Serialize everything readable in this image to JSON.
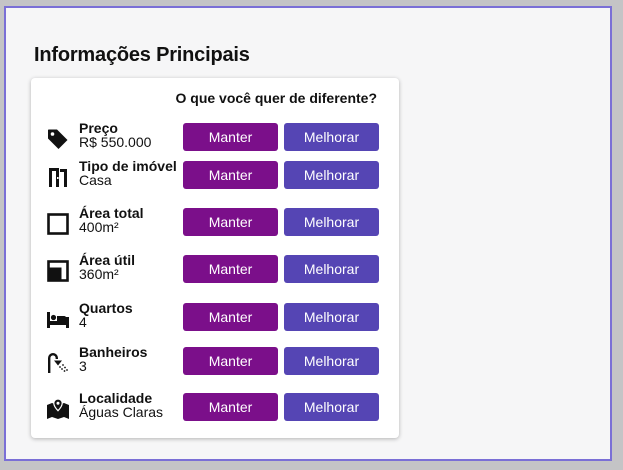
{
  "page": {
    "title": "Informações Principais"
  },
  "card": {
    "question": "O que você quer de diferente?",
    "keep_label": "Manter",
    "improve_label": "Melhorar",
    "rows": [
      {
        "label": "Preço",
        "value": "R$ 550.000",
        "icon": "price-tag-icon"
      },
      {
        "label": "Tipo de imóvel",
        "value": "Casa",
        "icon": "door-icon"
      },
      {
        "label": "Área total",
        "value": "400m²",
        "icon": "square-outline-icon"
      },
      {
        "label": "Área útil",
        "value": "360m²",
        "icon": "square-fill-icon"
      },
      {
        "label": "Quartos",
        "value": "4",
        "icon": "bed-icon"
      },
      {
        "label": "Banheiros",
        "value": "3",
        "icon": "shower-icon"
      },
      {
        "label": "Localidade",
        "value": "Águas Claras",
        "icon": "map-pin-icon"
      }
    ]
  },
  "colors": {
    "keep_button": "#7b0f8a",
    "improve_button": "#5545b4",
    "frame_border": "#7a6fd6"
  }
}
